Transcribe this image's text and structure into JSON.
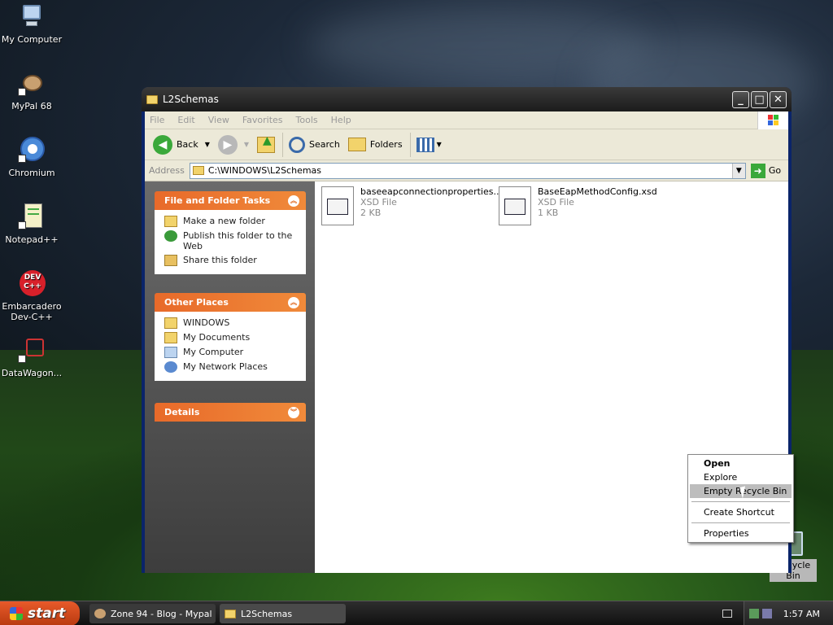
{
  "desktop": {
    "icons": [
      {
        "label": "My Computer"
      },
      {
        "label": "MyPal 68"
      },
      {
        "label": "Chromium"
      },
      {
        "label": "Notepad++"
      },
      {
        "label": "Embarcadero Dev-C++"
      },
      {
        "label": "DataWagon..."
      }
    ],
    "recycle_bin_label": "Recycle Bin"
  },
  "window": {
    "title": "L2Schemas",
    "menu": [
      "File",
      "Edit",
      "View",
      "Favorites",
      "Tools",
      "Help"
    ],
    "toolbar": {
      "back": "Back",
      "search": "Search",
      "folders": "Folders"
    },
    "address": {
      "label": "Address",
      "value": "C:\\WINDOWS\\L2Schemas",
      "go": "Go"
    },
    "tasks": {
      "file_folder": {
        "title": "File and Folder Tasks",
        "items": [
          "Make a new folder",
          "Publish this folder to the Web",
          "Share this folder"
        ]
      },
      "other_places": {
        "title": "Other Places",
        "items": [
          "WINDOWS",
          "My Documents",
          "My Computer",
          "My Network Places"
        ]
      },
      "details": {
        "title": "Details"
      }
    },
    "files": [
      {
        "name": "baseeapconnectionproperties...",
        "type": "XSD File",
        "size": "2 KB"
      },
      {
        "name": "BaseEapMethodConfig.xsd",
        "type": "XSD File",
        "size": "1 KB"
      }
    ]
  },
  "context_menu": {
    "items": [
      "Open",
      "Explore",
      "Empty Recycle Bin",
      "Create Shortcut",
      "Properties"
    ]
  },
  "taskbar": {
    "start": "start",
    "tasks": [
      "Zone 94 - Blog - Mypal",
      "L2Schemas"
    ],
    "clock": "1:57 AM"
  }
}
